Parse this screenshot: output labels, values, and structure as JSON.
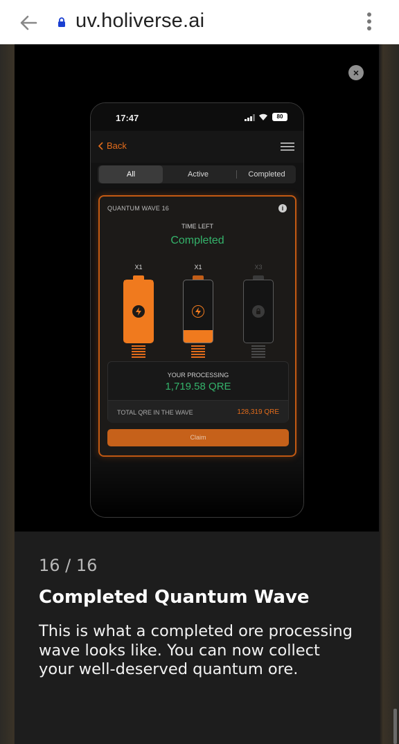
{
  "browser": {
    "url": "uv.holiverse.ai",
    "icons": [
      "back-arrow-icon",
      "lock-icon",
      "more-vert-icon"
    ]
  },
  "modal": {
    "close_icon": "×",
    "step_counter": "16 / 16",
    "title": "Completed Quantum Wave",
    "description": "This is what a completed ore processing wave looks like. You can now collect your well-deserved quantum ore."
  },
  "phone": {
    "status": {
      "time": "17:47",
      "battery": "80"
    },
    "header": {
      "back_label": "Back"
    },
    "tabs": [
      {
        "label": "All",
        "active": true
      },
      {
        "label": "Active",
        "active": false
      },
      {
        "label": "Completed",
        "active": false
      }
    ],
    "wave": {
      "title": "QUANTUM WAVE 16",
      "info_icon": "i",
      "time_left_label": "TIME LEFT",
      "status": "Completed",
      "batteries": [
        {
          "multiplier": "X1",
          "fill": 1.0,
          "icon": "bolt-icon",
          "state": "full"
        },
        {
          "multiplier": "X1",
          "fill": 0.2,
          "icon": "bolt-icon",
          "state": "partial"
        },
        {
          "multiplier": "X3",
          "fill": 0.0,
          "icon": "lock-icon",
          "state": "locked"
        }
      ],
      "processing_label": "YOUR PROCESSING",
      "processing_value": "1,719.58 QRE",
      "total_label": "TOTAL QRE IN THE WAVE",
      "total_value": "128,319 QRE",
      "claim_label": "Claim"
    }
  },
  "colors": {
    "accent": "#e36c1b",
    "success": "#34b36b",
    "background": "#1d1d1d"
  }
}
